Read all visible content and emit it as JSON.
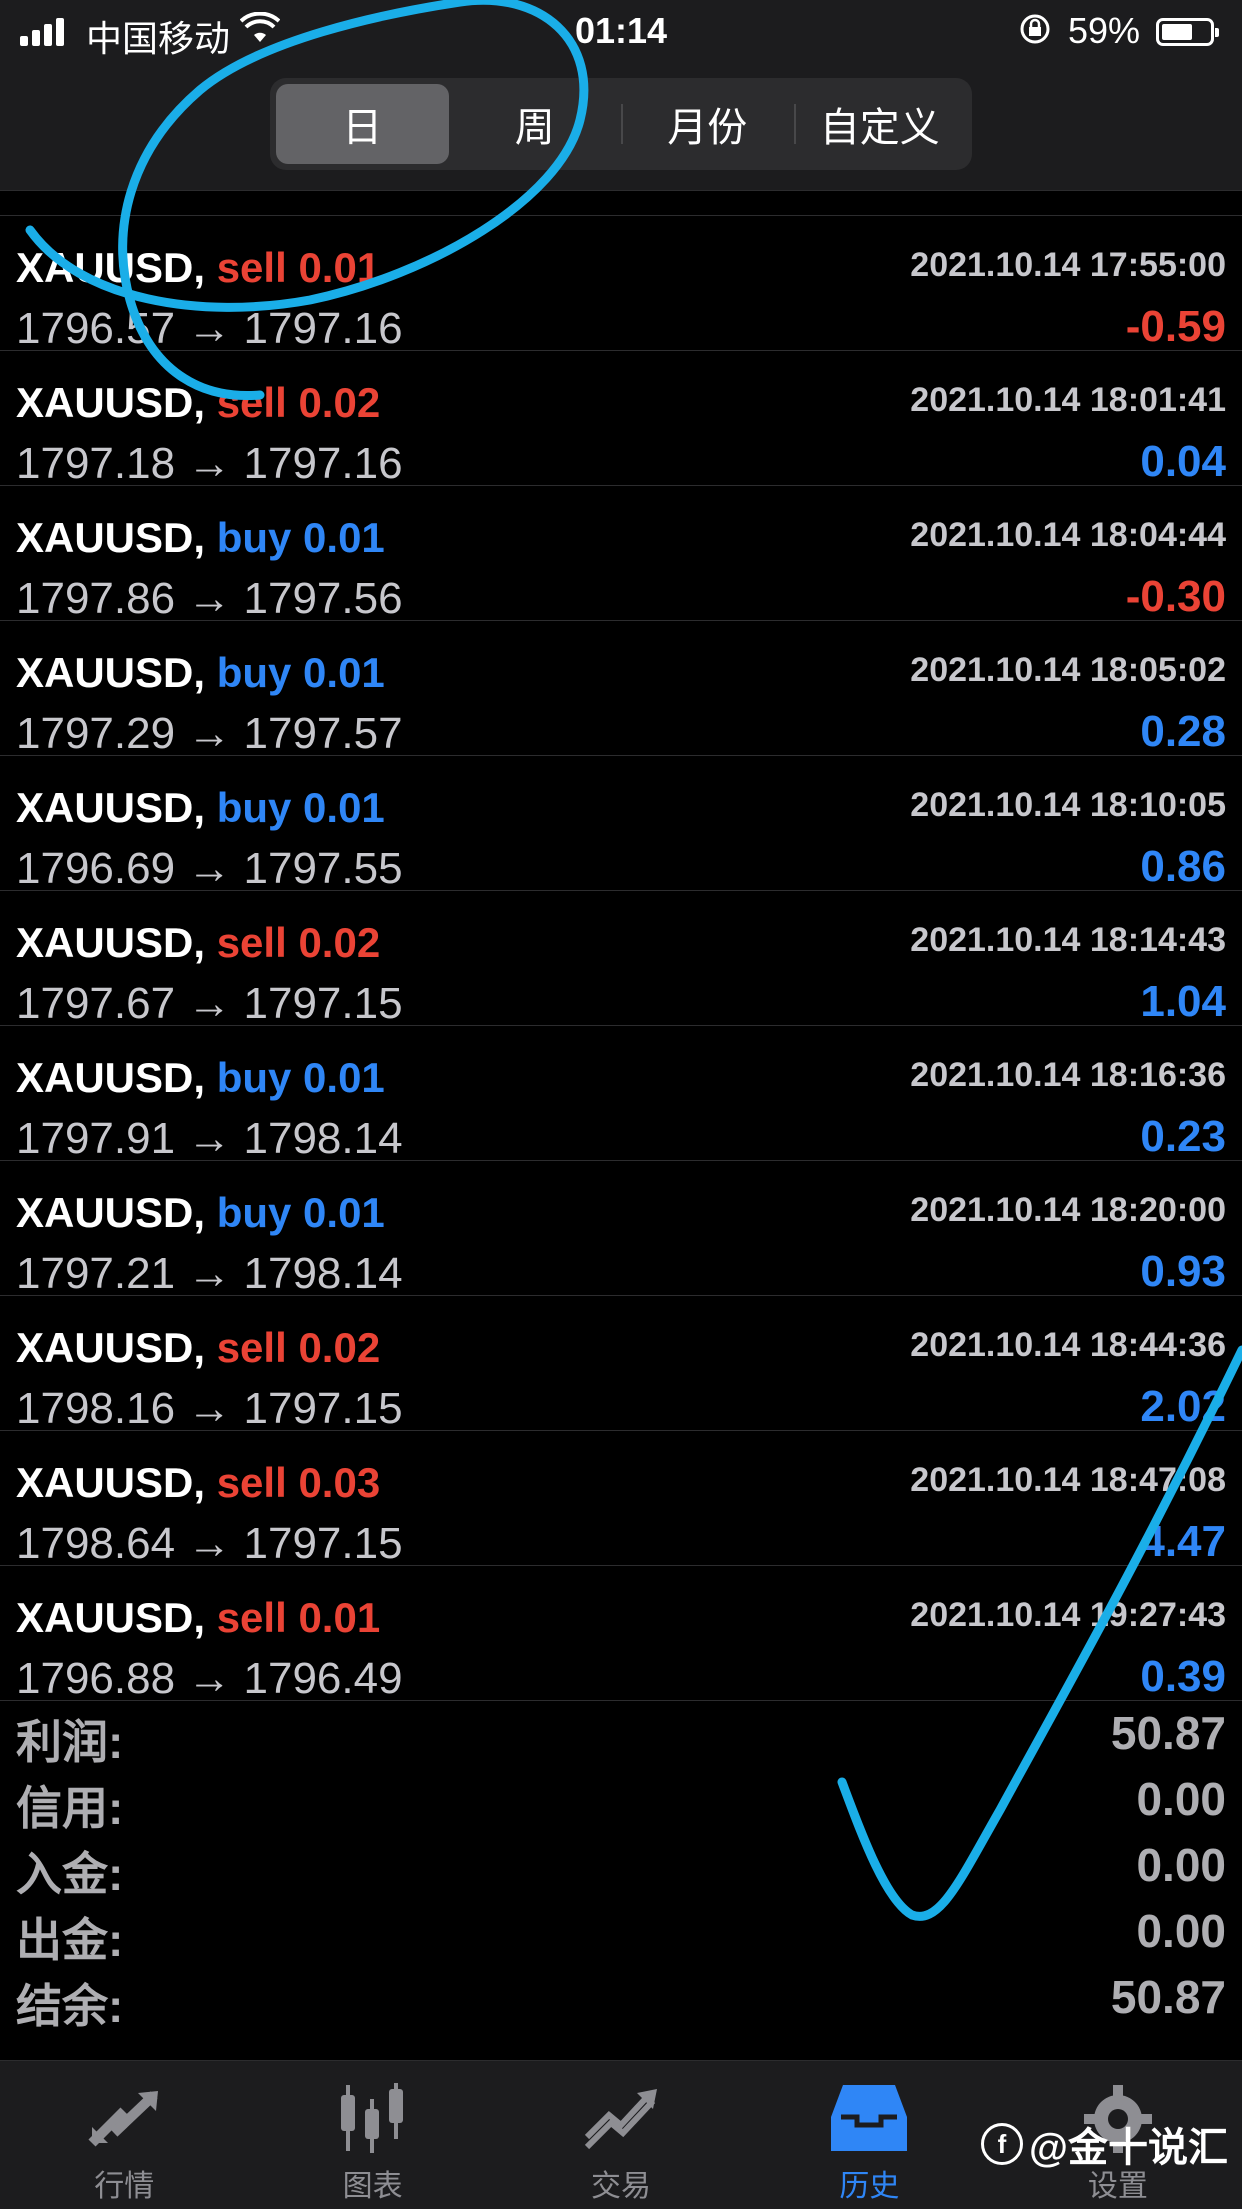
{
  "status_bar": {
    "carrier": "中国移动",
    "time": "01:14",
    "battery_percent": "59%"
  },
  "period_tabs": [
    {
      "label": "日",
      "active": true
    },
    {
      "label": "周",
      "active": false
    },
    {
      "label": "月份",
      "active": false
    },
    {
      "label": "自定义",
      "active": false
    }
  ],
  "trades": [
    {
      "symbol": "XAUUSD,",
      "side": "sell",
      "volume": "0.01",
      "time": "2021.10.14 17:55:00",
      "open": "1796.57",
      "close": "1797.16",
      "profit": "-0.59"
    },
    {
      "symbol": "XAUUSD,",
      "side": "sell",
      "volume": "0.02",
      "time": "2021.10.14 18:01:41",
      "open": "1797.18",
      "close": "1797.16",
      "profit": "0.04"
    },
    {
      "symbol": "XAUUSD,",
      "side": "buy",
      "volume": "0.01",
      "time": "2021.10.14 18:04:44",
      "open": "1797.86",
      "close": "1797.56",
      "profit": "-0.30"
    },
    {
      "symbol": "XAUUSD,",
      "side": "buy",
      "volume": "0.01",
      "time": "2021.10.14 18:05:02",
      "open": "1797.29",
      "close": "1797.57",
      "profit": "0.28"
    },
    {
      "symbol": "XAUUSD,",
      "side": "buy",
      "volume": "0.01",
      "time": "2021.10.14 18:10:05",
      "open": "1796.69",
      "close": "1797.55",
      "profit": "0.86"
    },
    {
      "symbol": "XAUUSD,",
      "side": "sell",
      "volume": "0.02",
      "time": "2021.10.14 18:14:43",
      "open": "1797.67",
      "close": "1797.15",
      "profit": "1.04"
    },
    {
      "symbol": "XAUUSD,",
      "side": "buy",
      "volume": "0.01",
      "time": "2021.10.14 18:16:36",
      "open": "1797.91",
      "close": "1798.14",
      "profit": "0.23"
    },
    {
      "symbol": "XAUUSD,",
      "side": "buy",
      "volume": "0.01",
      "time": "2021.10.14 18:20:00",
      "open": "1797.21",
      "close": "1798.14",
      "profit": "0.93"
    },
    {
      "symbol": "XAUUSD,",
      "side": "sell",
      "volume": "0.02",
      "time": "2021.10.14 18:44:36",
      "open": "1798.16",
      "close": "1797.15",
      "profit": "2.02"
    },
    {
      "symbol": "XAUUSD,",
      "side": "sell",
      "volume": "0.03",
      "time": "2021.10.14 18:47:08",
      "open": "1798.64",
      "close": "1797.15",
      "profit": "4.47"
    },
    {
      "symbol": "XAUUSD,",
      "side": "sell",
      "volume": "0.01",
      "time": "2021.10.14 19:27:43",
      "open": "1796.88",
      "close": "1796.49",
      "profit": "0.39"
    }
  ],
  "summary": [
    {
      "label": "利润:",
      "value": "50.87"
    },
    {
      "label": "信用:",
      "value": "0.00"
    },
    {
      "label": "入金:",
      "value": "0.00"
    },
    {
      "label": "出金:",
      "value": "0.00"
    },
    {
      "label": "结余:",
      "value": "50.87"
    }
  ],
  "tab_bar": [
    {
      "label": "行情",
      "icon": "quotes-arrows-icon",
      "active": false
    },
    {
      "label": "图表",
      "icon": "candlestick-chart-icon",
      "active": false
    },
    {
      "label": "交易",
      "icon": "trade-trend-icon",
      "active": false
    },
    {
      "label": "历史",
      "icon": "history-inbox-icon",
      "active": true
    },
    {
      "label": "设置",
      "icon": "gear-icon",
      "active": false
    }
  ],
  "watermark": "@金十说汇",
  "colors": {
    "sell": "#ea4335",
    "buy": "#2f86f6",
    "annotation": "#1aaee8"
  }
}
